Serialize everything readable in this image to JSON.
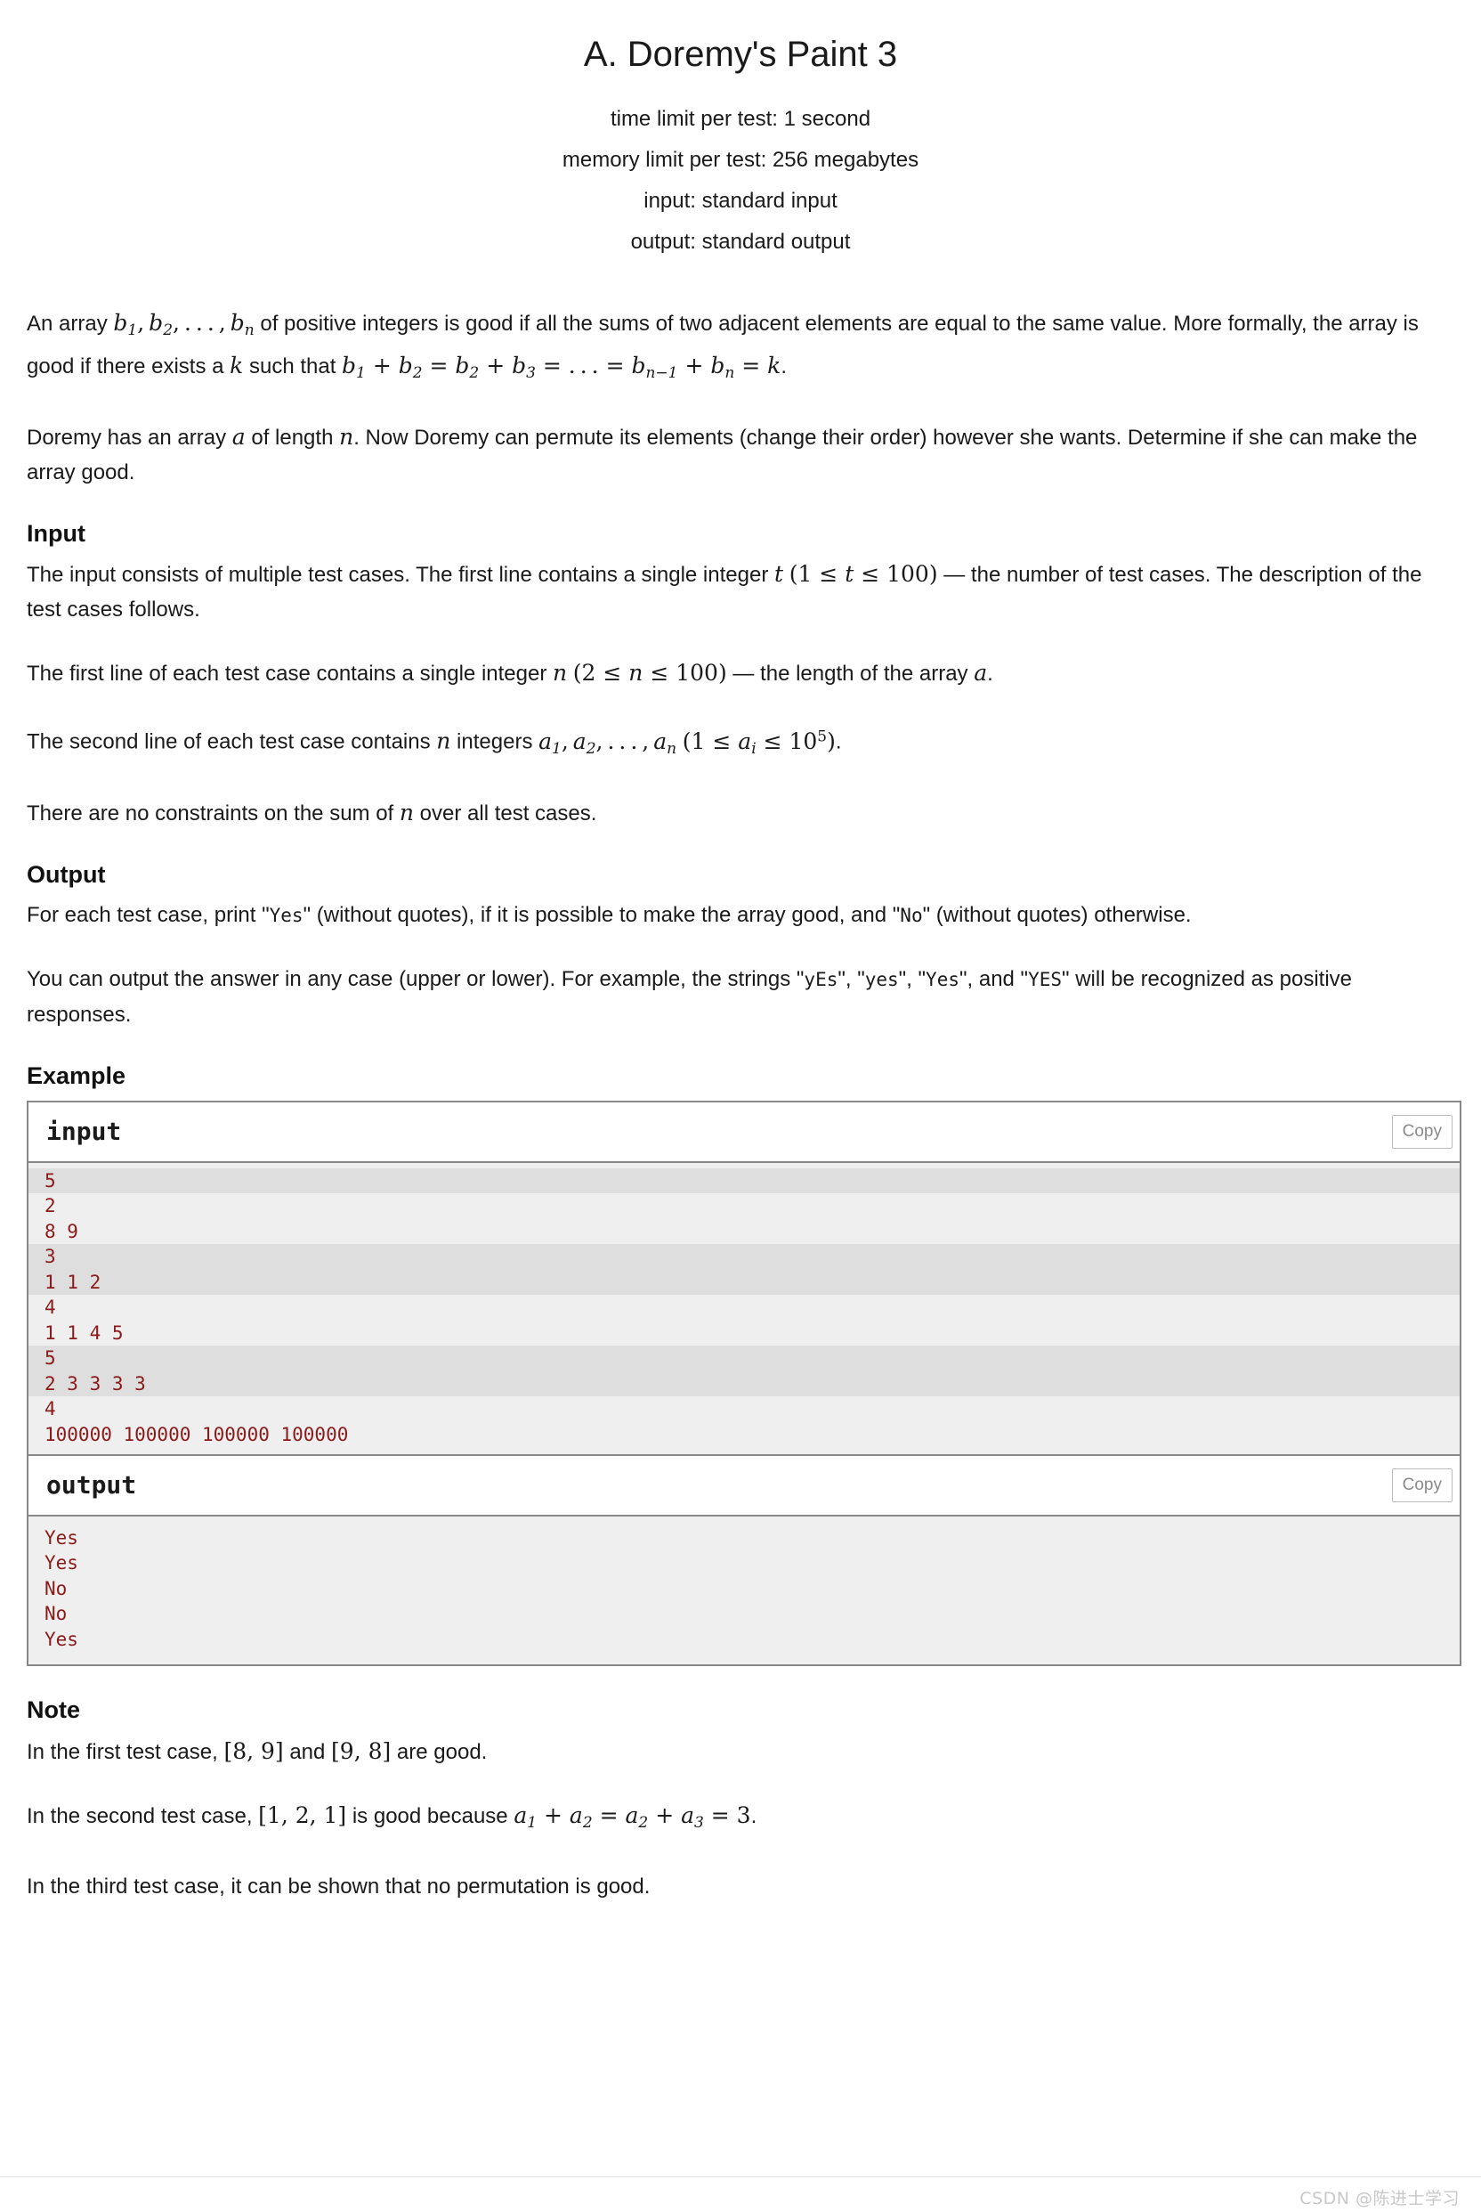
{
  "header": {
    "title": "A. Doremy's Paint 3",
    "limits": [
      "time limit per test: 1 second",
      "memory limit per test: 256 megabytes",
      "input: standard input",
      "output: standard output"
    ]
  },
  "statement": {
    "p1_a": "An array ",
    "p1_b": " of positive integers is good if all the sums of two adjacent elements are equal to the same value. More formally, the array is good if there exists a ",
    "p1_c": " such that ",
    "p1_d": ".",
    "p2_a": "Doremy has an array ",
    "p2_b": " of length ",
    "p2_c": ". Now Doremy can permute its elements (change their order) however she wants. Determine if she can make the array good."
  },
  "input_section": {
    "heading": "Input",
    "p1_a": "The input consists of multiple test cases. The first line contains a single integer ",
    "p1_b": " — the number of test cases. The description of the test cases follows.",
    "p2_a": "The first line of each test case contains a single integer ",
    "p2_b": " — the length of the array ",
    "p2_c": ".",
    "p3_a": "The second line of each test case contains ",
    "p3_b": " integers ",
    "p3_c": ".",
    "p4_a": "There are no constraints on the sum of ",
    "p4_b": " over all test cases."
  },
  "output_section": {
    "heading": "Output",
    "p1_a": "For each test case, print \"",
    "p1_yes": "Yes",
    "p1_b": "\" (without quotes), if it is possible to make the array good, and \"",
    "p1_no": "No",
    "p1_c": "\" (without quotes) otherwise.",
    "p2_a": "You can output the answer in any case (upper or lower). For example, the strings \"",
    "p2_v1": "yEs",
    "p2_b": "\", \"",
    "p2_v2": "yes",
    "p2_c": "\", \"",
    "p2_v3": "Yes",
    "p2_d": "\", and \"",
    "p2_v4": "YES",
    "p2_e": "\" will be recognized as positive responses."
  },
  "example": {
    "heading": "Example",
    "input_label": "input",
    "output_label": "output",
    "copy_label": "Copy",
    "input_groups": [
      {
        "shaded": true,
        "lines": [
          "5"
        ]
      },
      {
        "shaded": false,
        "lines": [
          "2",
          "8 9"
        ]
      },
      {
        "shaded": true,
        "lines": [
          "3",
          "1 1 2"
        ]
      },
      {
        "shaded": false,
        "lines": [
          "4",
          "1 1 4 5"
        ]
      },
      {
        "shaded": true,
        "lines": [
          "5",
          "2 3 3 3 3"
        ]
      },
      {
        "shaded": false,
        "lines": [
          "4",
          "100000 100000 100000 100000"
        ]
      }
    ],
    "output_lines": [
      "Yes",
      "Yes",
      "No",
      "No",
      "Yes"
    ]
  },
  "note_section": {
    "heading": "Note",
    "p1_a": "In the first test case, ",
    "p1_arr1": "[8, 9]",
    "p1_b": " and ",
    "p1_arr2": "[9, 8]",
    "p1_c": " are good.",
    "p2_a": "In the second test case, ",
    "p2_arr": "[1, 2, 1]",
    "p2_b": " is good because ",
    "p2_c": ".",
    "p3": "In the third test case, it can be shown that no permutation is good."
  },
  "footer": {
    "watermark": "CSDN @陈进士学习"
  },
  "colors": {
    "sample_text": "#8b1a1a",
    "sample_bg": "#efefef",
    "sample_bg_alt": "#dedede",
    "border": "#888888"
  }
}
